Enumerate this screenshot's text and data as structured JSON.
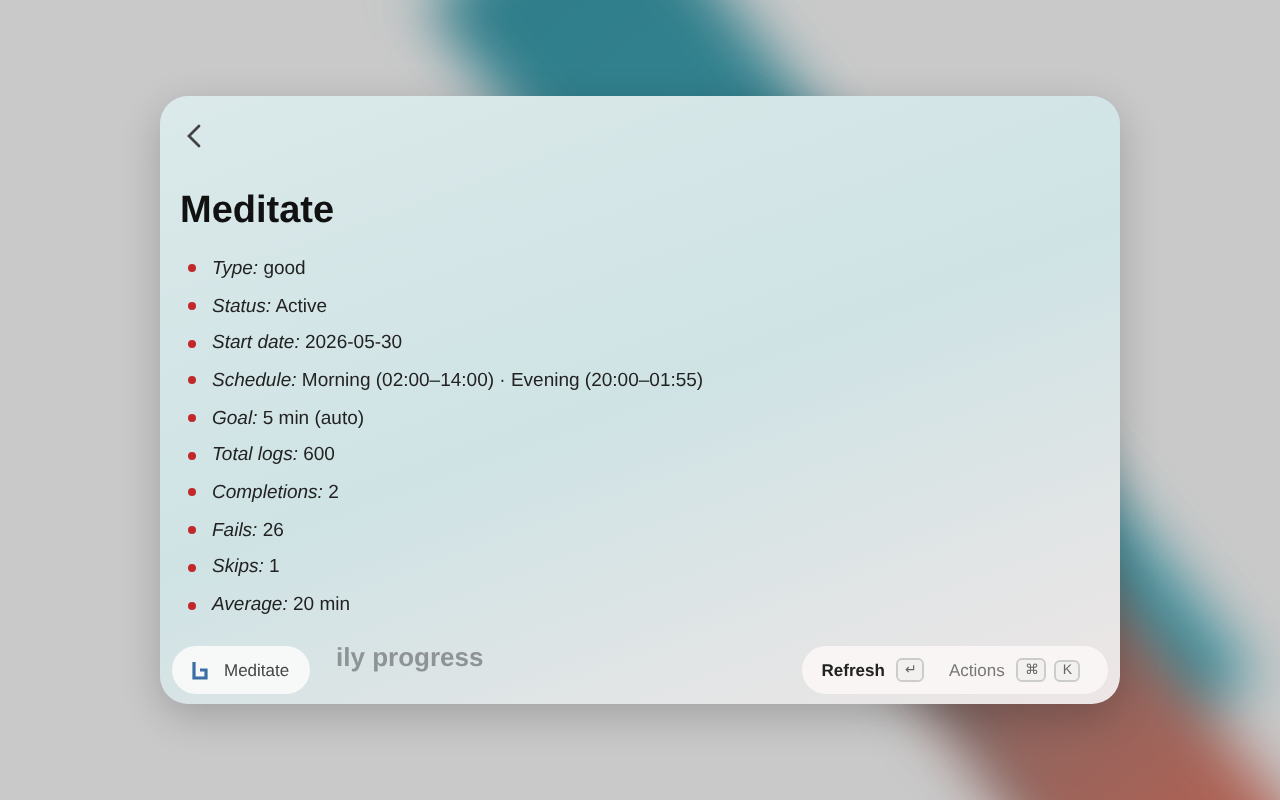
{
  "title": "Meditate",
  "details": [
    "*Type:* good",
    "*Status:* Active",
    "*Start date:* 2026-05-30",
    "*Schedule:* Morning (02:00–14:00) · Evening (20:00–01:55)",
    "*Goal:* 5 min (auto)",
    "*Total logs:* 600",
    "*Completions:* 2",
    "*Fails:* 26",
    "*Skips:* 1",
    "*Average:* 20 min"
  ],
  "section_heading": "ily progress",
  "chip": {
    "label": "Meditate"
  },
  "footer": {
    "primary": {
      "label": "Refresh",
      "keys": [
        "↵"
      ]
    },
    "secondary": {
      "label": "Actions",
      "keys": [
        "⌘",
        "K"
      ]
    }
  }
}
